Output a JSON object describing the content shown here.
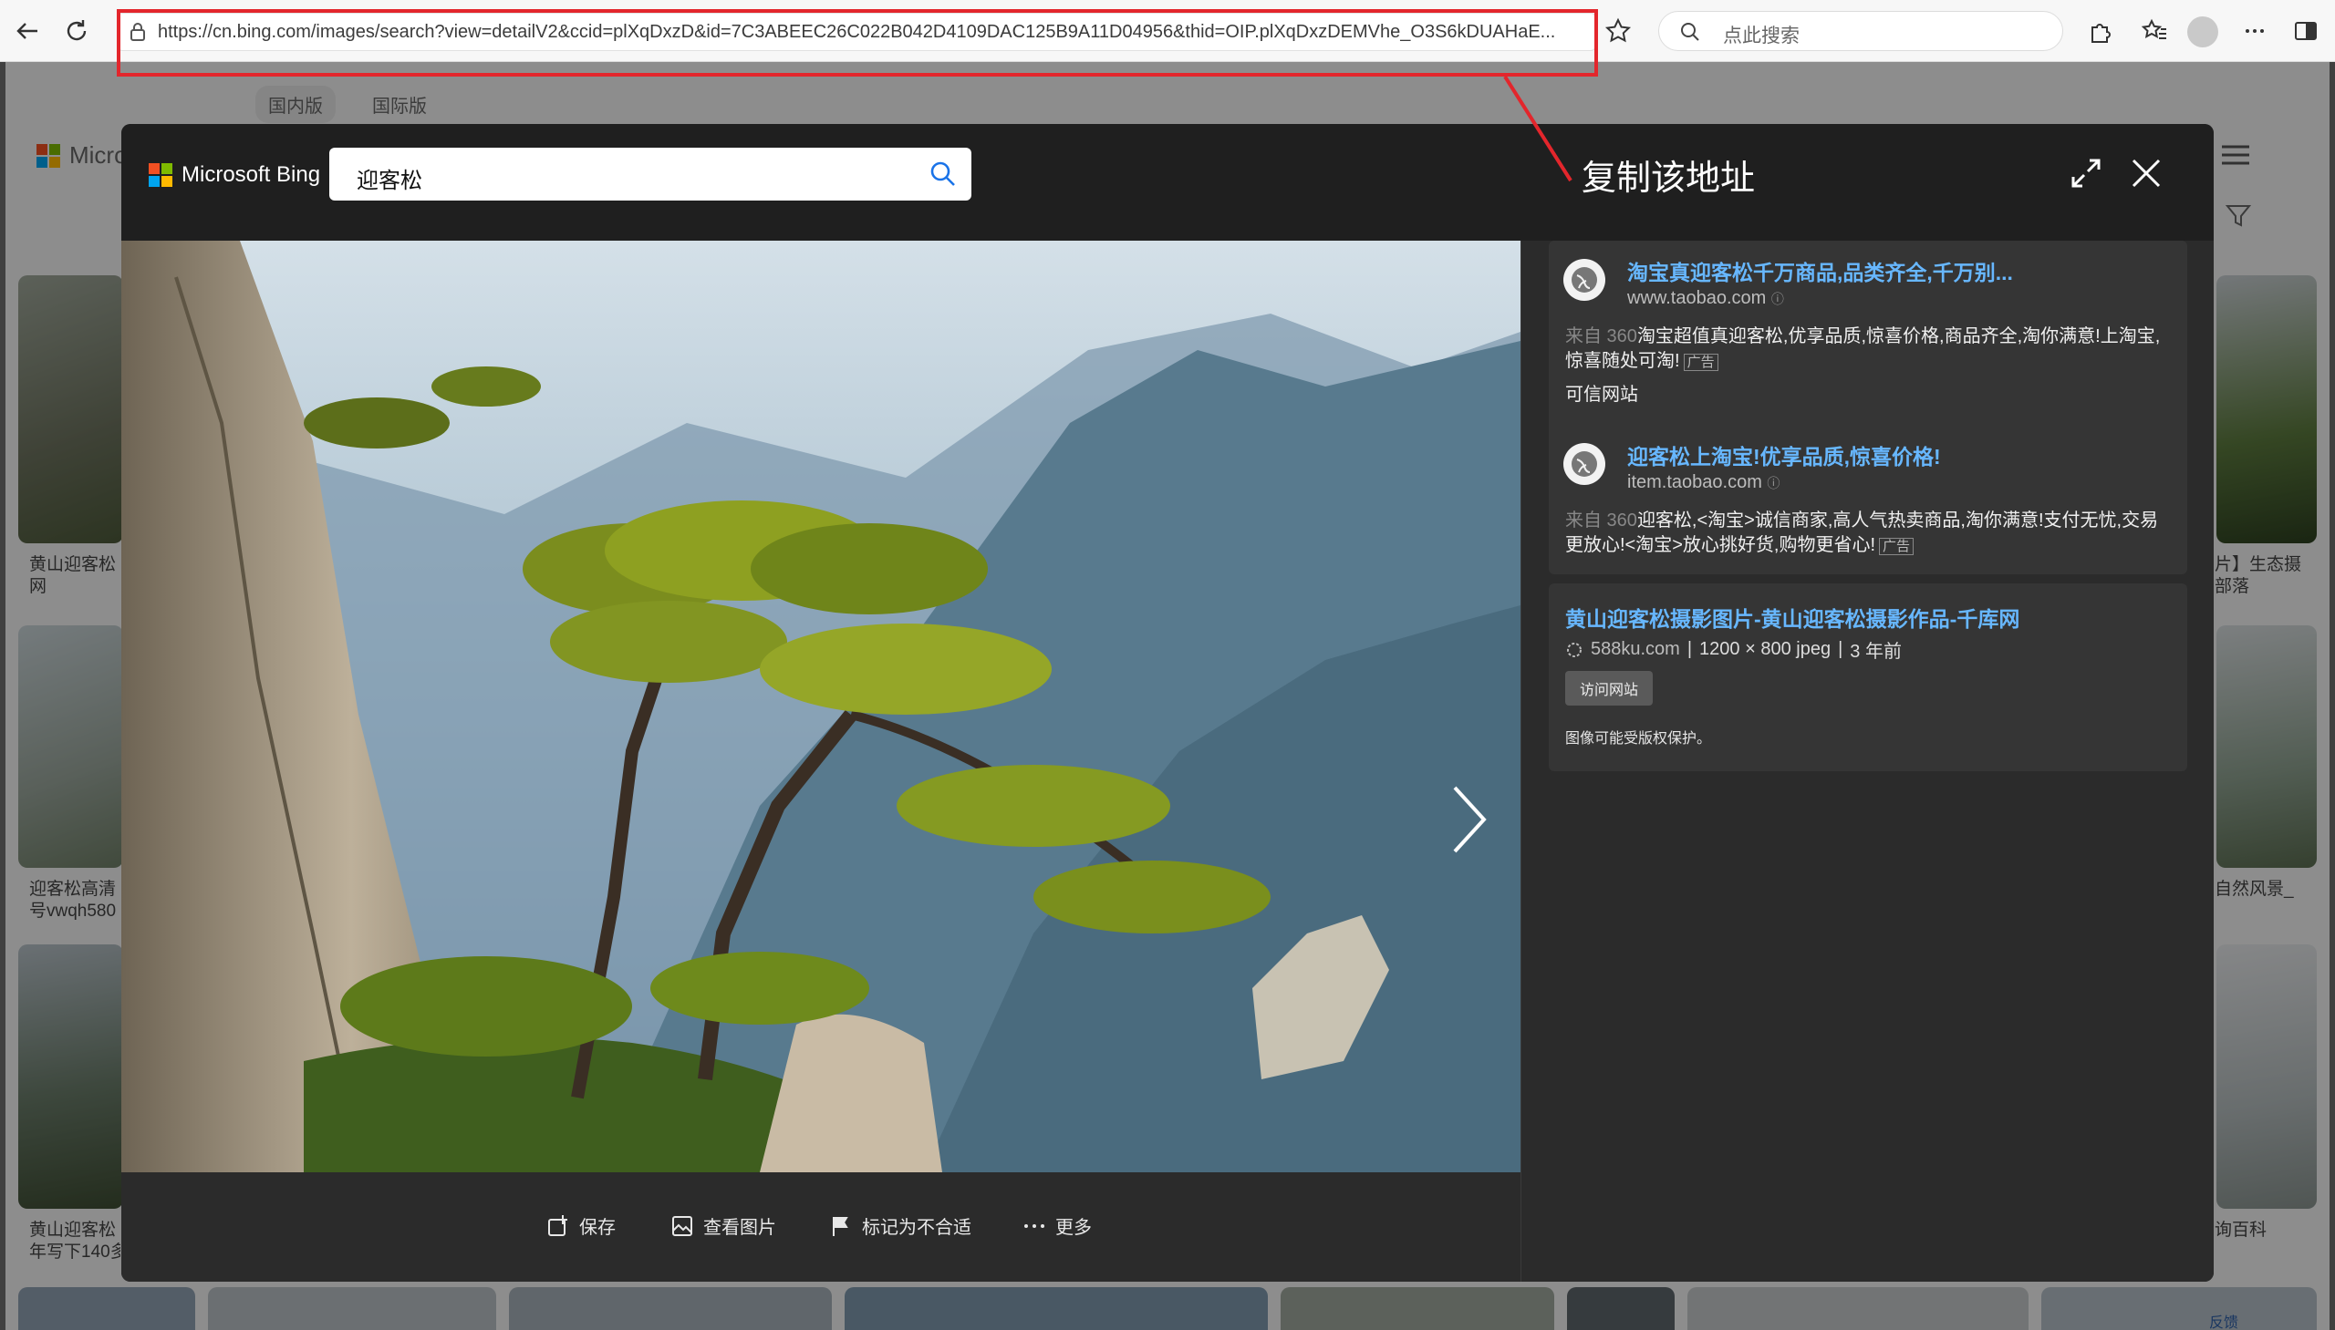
{
  "browser": {
    "url": "https://cn.bing.com/images/search?view=detailV2&ccid=plXqDxzD&id=7C3ABEEC26C022B042D4109DAC125B9A11D04956&thid=OIP.plXqDxzDEMVhe_O3S6kDUAHaE...",
    "search_placeholder": "点此搜索"
  },
  "background_page": {
    "tabs": [
      "国内版",
      "国际版"
    ],
    "logo_text": "Micro",
    "captions_left": [
      "黄山迎客松",
      "网",
      "迎客松高清",
      "号vwqh580",
      "黄山迎客松",
      "年写下140多"
    ],
    "captions_right": [
      "片】生态摄",
      "部落",
      "自然风景_",
      "询百科"
    ],
    "feedback": "反馈"
  },
  "modal": {
    "brand": "Microsoft Bing",
    "query": "迎客松",
    "annotation": "复制该地址",
    "actions": {
      "save": "保存",
      "view_image": "查看图片",
      "flag": "标记为不合适",
      "more": "更多"
    },
    "ads": [
      {
        "title": "淘宝真迎客松千万商品,品类齐全,千万别...",
        "domain": "www.taobao.com",
        "source": "来自 360",
        "desc": "淘宝超值真迎客松,优享品质,惊喜价格,商品齐全,淘你满意!上淘宝,惊喜随处可淘!",
        "ad_tag": "广告",
        "trust": "可信网站"
      },
      {
        "title": "迎客松上淘宝!优享品质,惊喜价格!",
        "domain": "item.taobao.com",
        "source": "来自 360",
        "desc": "迎客松,<淘宝>诚信商家,高人气热卖商品,淘你满意!支付无忧,交易更放心!<淘宝>放心挑好货,购物更省心!",
        "ad_tag": "广告"
      }
    ],
    "image_info": {
      "title": "黄山迎客松摄影图片-黄山迎客松摄影作品-千库网",
      "site": "588ku.com",
      "dimensions": "1200 × 800 jpeg",
      "age": "3 年前",
      "sep": "|",
      "visit": "访问网站",
      "copyright": "图像可能受版权保护。"
    }
  },
  "colors": {
    "link": "#67b7ff",
    "annotation_red": "#e3262c",
    "modal_bg": "#2b2b2b"
  }
}
